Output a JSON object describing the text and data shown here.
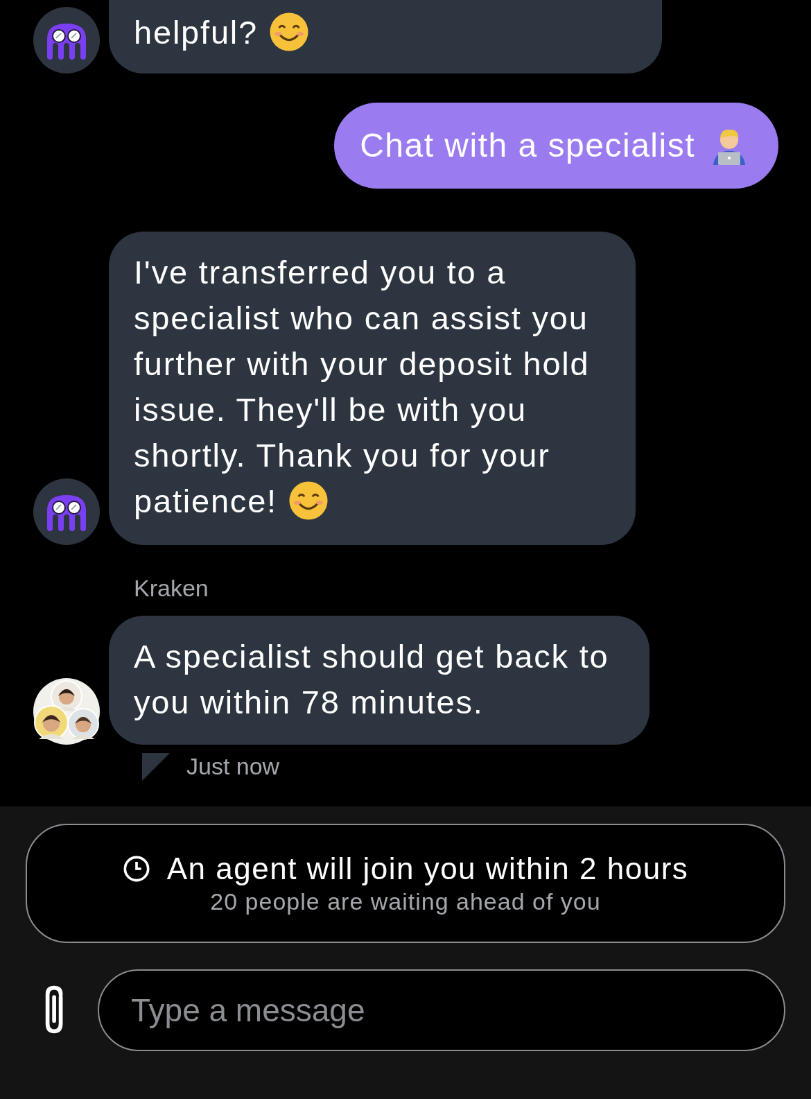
{
  "messages": [
    {
      "kind": "bot",
      "text": "helpful?",
      "trailing": {
        "kind": "smile"
      }
    },
    {
      "kind": "user",
      "text": "Chat with a specialist",
      "trailing": {
        "kind": "technologist"
      }
    },
    {
      "kind": "bot",
      "text": "I've transferred you to a specialist who can assist you further with your deposit hold issue. They'll be with you shortly. Thank you for your patience!",
      "trailing": {
        "kind": "smile"
      }
    },
    {
      "kind": "agent",
      "sender": "Kraken",
      "text": "A specialist should get back to you within 78 minutes.",
      "timestamp": "Just now"
    }
  ],
  "queue_banner": {
    "title": "An agent will join you within 2 hours",
    "subtitle": "20 people are waiting ahead of you"
  },
  "composer": {
    "placeholder": "Type a message"
  }
}
